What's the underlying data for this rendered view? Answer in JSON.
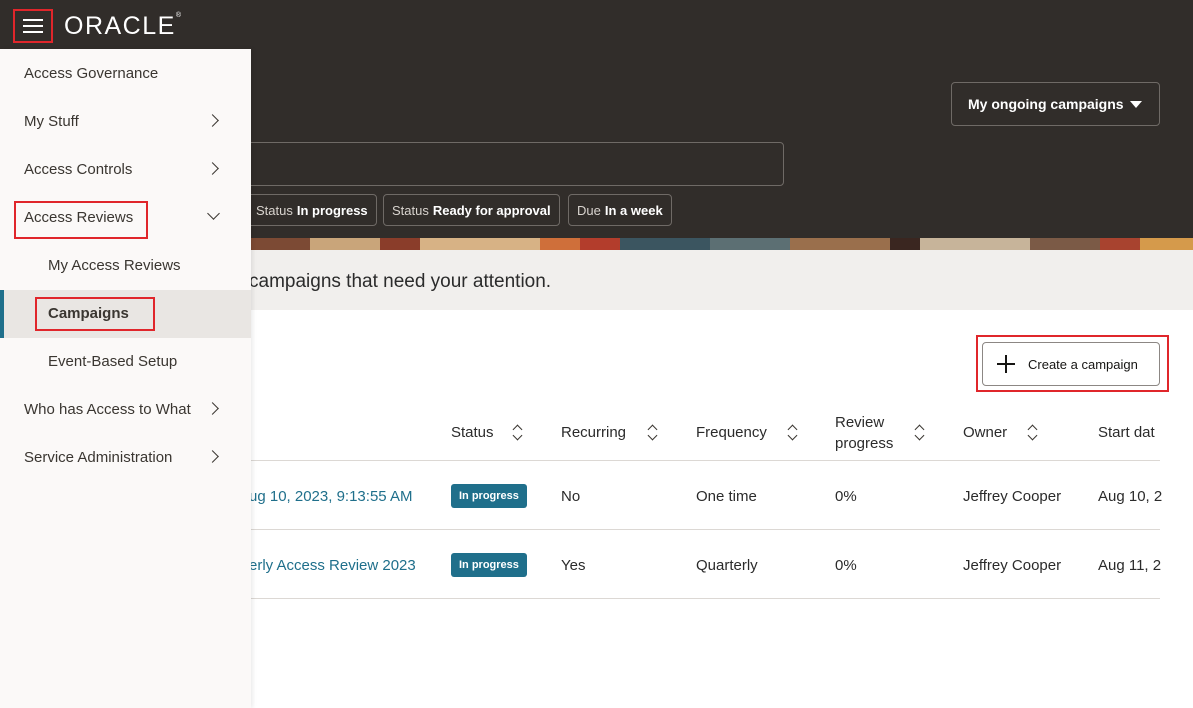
{
  "header": {
    "logo_text": "ORACLE",
    "menu_icon": "hamburger-menu-icon"
  },
  "hero": {
    "dropdown_label": "My ongoing campaigns",
    "chips": [
      {
        "key": "Status",
        "value": "In progress"
      },
      {
        "key": "Status",
        "value": "Ready for approval"
      },
      {
        "key": "Due",
        "value": "In a week"
      }
    ]
  },
  "attention_text": "campaigns that need your attention.",
  "create_button_label": "Create a campaign",
  "table": {
    "headers": [
      "Status",
      "Recurring",
      "Frequency",
      "Review progress",
      "Owner",
      "Start dat"
    ],
    "review_header_line1": "Review",
    "review_header_line2": "progress",
    "rows": [
      {
        "name": "ug 10, 2023, 9:13:55 AM",
        "status": "In progress",
        "recurring": "No",
        "frequency": "One time",
        "progress": "0%",
        "owner": "Jeffrey Cooper",
        "start": "Aug 10, 2"
      },
      {
        "name": "erly Access Review 2023",
        "status": "In progress",
        "recurring": "Yes",
        "frequency": "Quarterly",
        "progress": "0%",
        "owner": "Jeffrey Cooper",
        "start": "Aug 11, 2"
      }
    ]
  },
  "sidebar": {
    "items": [
      {
        "label": "Access Governance"
      },
      {
        "label": "My Stuff"
      },
      {
        "label": "Access Controls"
      },
      {
        "label": "Access Reviews"
      },
      {
        "label": "My Access Reviews"
      },
      {
        "label": "Campaigns"
      },
      {
        "label": "Event-Based Setup"
      },
      {
        "label": "Who has Access to What"
      },
      {
        "label": "Service Administration"
      }
    ]
  },
  "colors": {
    "header_bg": "#312d2a",
    "accent_teal": "#1f6f8b",
    "highlight_red": "#e0262b"
  }
}
